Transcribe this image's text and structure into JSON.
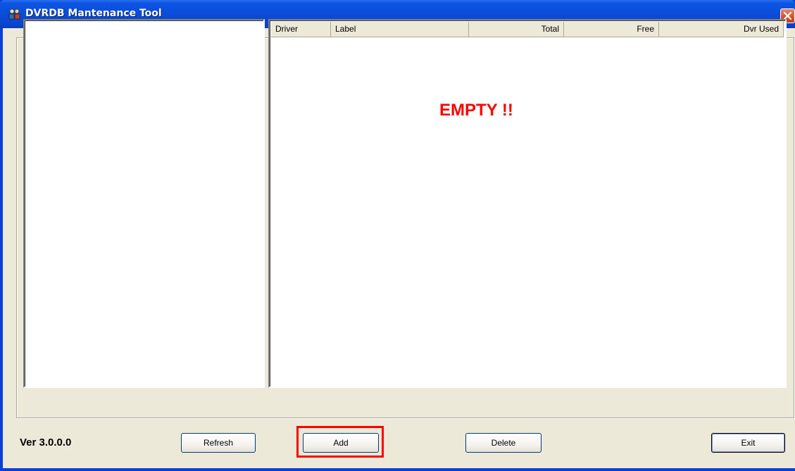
{
  "window": {
    "title": "DVRDB Mantenance Tool",
    "icon": "app-icon",
    "close_icon": "close-icon"
  },
  "list": {
    "columns": [
      {
        "label": "Driver",
        "align": "left"
      },
      {
        "label": "Label",
        "align": "left"
      },
      {
        "label": "Total",
        "align": "right"
      },
      {
        "label": "Free",
        "align": "right"
      },
      {
        "label": "Dvr Used",
        "align": "right"
      }
    ],
    "rows": [],
    "overlay_text": "EMPTY !!",
    "overlay_color": "#ff0000"
  },
  "tree": {
    "items": []
  },
  "footer": {
    "version": "Ver 3.0.0.0",
    "refresh_label": "Refresh",
    "add_label": "Add",
    "delete_label": "Delete",
    "exit_label": "Exit"
  },
  "colors": {
    "titlebar": "#0a4cd8",
    "client_bg": "#ece9d8",
    "highlight": "#ff0000"
  }
}
